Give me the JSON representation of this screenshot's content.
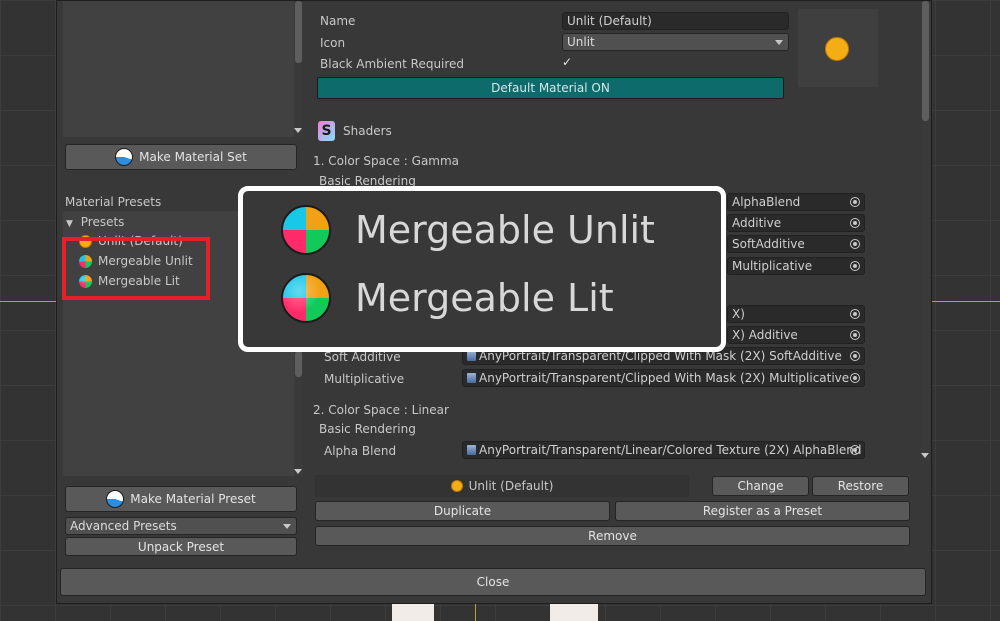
{
  "left_panel": {
    "make_material_set_label": "Make Material Set",
    "material_presets_label": "Material Presets",
    "presets_folder_label": "Presets",
    "preset_items": [
      "Unlit (Default)",
      "Mergeable Unlit",
      "Mergeable Lit"
    ],
    "make_material_preset_label": "Make Material Preset",
    "advanced_presets_value": "Advanced Presets",
    "unpack_preset_label": "Unpack Preset"
  },
  "properties": {
    "name_label": "Name",
    "name_value": "Unlit (Default)",
    "icon_label": "Icon",
    "icon_value": "Unlit",
    "black_ambient_label": "Black Ambient Required",
    "black_ambient_checked": true,
    "default_material_label": "Default Material ON",
    "default_material_color": "#0e6b6b"
  },
  "shaders": {
    "header": "Shaders",
    "gamma_section": "1. Color Space : Gamma",
    "gamma_basic_rendering": "Basic Rendering",
    "gamma_basic_fields": [
      "AlphaBlend",
      "Additive",
      "SoftAdditive",
      "Multiplicative"
    ],
    "gamma_mask_fields": [
      "X)",
      "X) Additive",
      "AnyPortrait/Transparent/Clipped With Mask (2X) SoftAdditive",
      "AnyPortrait/Transparent/Clipped With Mask (2X) Multiplicative"
    ],
    "soft_additive_label": "Soft Additive",
    "multiplicative_label": "Multiplicative",
    "linear_section": "2. Color Space : Linear",
    "linear_basic_rendering": "Basic Rendering",
    "alpha_blend_label": "Alpha Blend",
    "linear_alpha_blend_value": "AnyPortrait/Transparent/Linear/Colored Texture (2X) AlphaBlend"
  },
  "bottom": {
    "selected_preset": "Unlit (Default)",
    "change_label": "Change",
    "restore_label": "Restore",
    "duplicate_label": "Duplicate",
    "register_label": "Register as a Preset",
    "remove_label": "Remove",
    "close_label": "Close"
  },
  "callout": {
    "unlit_label": "Mergeable Unlit",
    "lit_label": "Mergeable Lit"
  },
  "icons": {
    "check": "✓",
    "folder_arrow": "▼",
    "shader_icon_letter": "S"
  }
}
